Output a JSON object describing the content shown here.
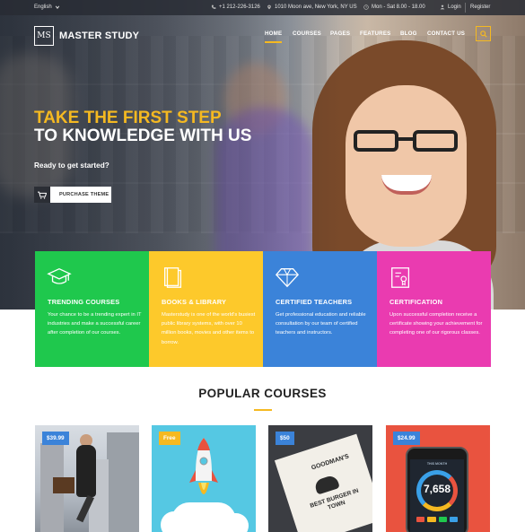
{
  "topbar": {
    "language": "English",
    "phone": "+1 212-226-3126",
    "address": "1010 Moon ave, New York, NY US",
    "hours": "Mon - Sat 8.00 - 18.00",
    "login": "Login",
    "register": "Register"
  },
  "brand": {
    "logo_mark": "MS",
    "name": "MASTER STUDY"
  },
  "nav": {
    "items": [
      "HOME",
      "COURSES",
      "PAGES",
      "FEATURES",
      "BLOG",
      "CONTACT US"
    ]
  },
  "hero": {
    "headline_1": "TAKE THE FIRST STEP",
    "headline_2": "TO KNOWLEDGE WITH US",
    "subline": "Ready to get started?",
    "cta_label": "PURCHASE THEME"
  },
  "features": [
    {
      "title": "TRENDING COURSES",
      "text": "Your chance to be a trending expert in IT industries and make a successful career after completion of our courses.",
      "color": "#1fc84d",
      "icon": "graduation-cap-icon"
    },
    {
      "title": "BOOKS & LIBRARY",
      "text": "Masterstudy is one of the world's busiest public library systems, with over 10 million books, movies and other items to borrow.",
      "color": "#fdc92b",
      "icon": "book-icon"
    },
    {
      "title": "CERTIFIED TEACHERS",
      "text": "Get professional education and reliable consultation by our team of certified teachers and instructors.",
      "color": "#3b83d9",
      "icon": "diamond-icon"
    },
    {
      "title": "CERTIFICATION",
      "text": "Upon successful completion receive a certificate showing your achievement for completing one of our rigorous classes.",
      "color": "#ea3bb0",
      "icon": "certificate-icon"
    }
  ],
  "popular": {
    "title": "POPULAR COURSES",
    "courses": [
      {
        "price": "$39.99",
        "badge_color": "#3b83d9"
      },
      {
        "price": "Free",
        "badge_color": "#f5b921"
      },
      {
        "price": "$50",
        "badge_color": "#3b83d9"
      },
      {
        "price": "$24.99",
        "badge_color": "#3b83d9"
      }
    ],
    "course3_art_top": "GOODMAN'S",
    "course3_art_bottom": "BEST BURGER IN TOWN",
    "course4_art_month": "THIS MONTH",
    "course4_art_number": "7,658"
  },
  "colors": {
    "accent": "#f5b921",
    "dark": "#2b2e35"
  }
}
